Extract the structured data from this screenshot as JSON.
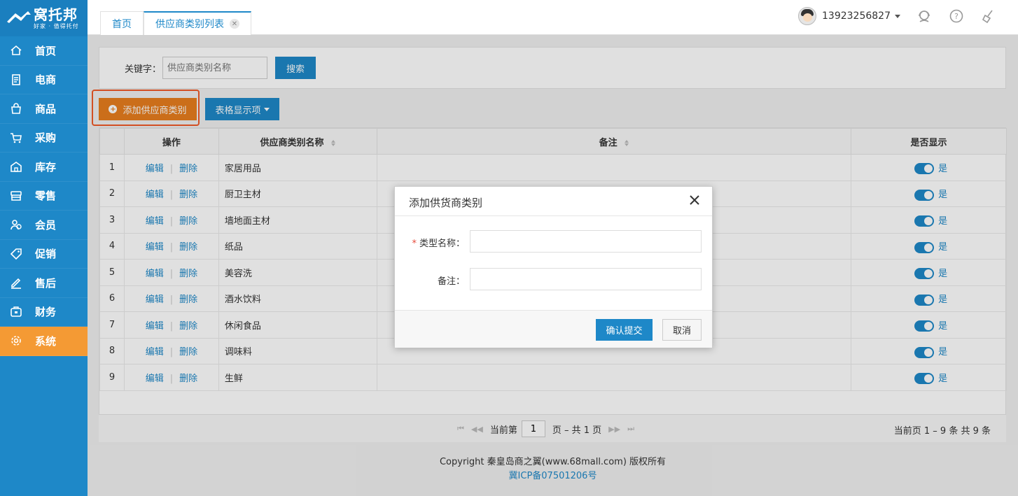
{
  "app": {
    "brand": "窝托邦",
    "slogan": "好家 · 值得托付"
  },
  "sidebar": {
    "items": [
      {
        "label": "首页",
        "icon": "home-icon"
      },
      {
        "label": "电商",
        "icon": "document-icon"
      },
      {
        "label": "商品",
        "icon": "bag-icon"
      },
      {
        "label": "采购",
        "icon": "cart-icon"
      },
      {
        "label": "库存",
        "icon": "warehouse-icon"
      },
      {
        "label": "零售",
        "icon": "store-icon"
      },
      {
        "label": "会员",
        "icon": "members-icon"
      },
      {
        "label": "促销",
        "icon": "tag-icon"
      },
      {
        "label": "售后",
        "icon": "pencil-icon"
      },
      {
        "label": "财务",
        "icon": "wallet-icon"
      },
      {
        "label": "系统",
        "icon": "gear-icon",
        "active": true
      }
    ]
  },
  "header": {
    "tabs": [
      {
        "label": "首页"
      },
      {
        "label": "供应商类别列表",
        "active": true
      }
    ],
    "user_phone": "13923256827"
  },
  "search": {
    "label": "关键字：",
    "placeholder": "供应商类别名称",
    "button": "搜索"
  },
  "toolbar": {
    "add_label": "添加供应商类别",
    "columns_label": "表格显示项"
  },
  "table": {
    "headers": {
      "op": "操作",
      "name": "供应商类别名称",
      "note": "备注",
      "show": "是否显示"
    },
    "edit_label": "编辑",
    "delete_label": "删除",
    "rows": [
      {
        "num": "1",
        "name": "家居用品",
        "note": "",
        "show": "是"
      },
      {
        "num": "2",
        "name": "厨卫主材",
        "note": "",
        "show": "是"
      },
      {
        "num": "3",
        "name": "墙地面主材",
        "note": "",
        "show": "是"
      },
      {
        "num": "4",
        "name": "纸品",
        "note": "",
        "show": "是"
      },
      {
        "num": "5",
        "name": "美容洗",
        "note": "",
        "show": "是"
      },
      {
        "num": "6",
        "name": "酒水饮料",
        "note": "",
        "show": "是"
      },
      {
        "num": "7",
        "name": "休闲食品",
        "note": "",
        "show": "是"
      },
      {
        "num": "8",
        "name": "调味料",
        "note": "",
        "show": "是"
      },
      {
        "num": "9",
        "name": "生鲜",
        "note": "",
        "show": "是"
      }
    ]
  },
  "pager": {
    "current_prefix": "当前第",
    "page_value": "1",
    "total_text": "页 – 共 1 页",
    "summary": "当前页 1 – 9 条   共 9 条"
  },
  "footer": {
    "copyright": "Copyright 秦皇岛商之翼(www.68mall.com) 版权所有",
    "icp": "冀ICP备07501206号"
  },
  "modal": {
    "title": "添加供货商类别",
    "field_type_label": "类型名称：",
    "field_type_value": "",
    "field_note_label": "备注：",
    "field_note_value": "",
    "confirm": "确认提交",
    "cancel": "取消"
  },
  "colors": {
    "primary": "#1e88c8",
    "active_menu": "#f49a34",
    "add_button": "#e87e1e",
    "highlight": "#f05a28"
  }
}
